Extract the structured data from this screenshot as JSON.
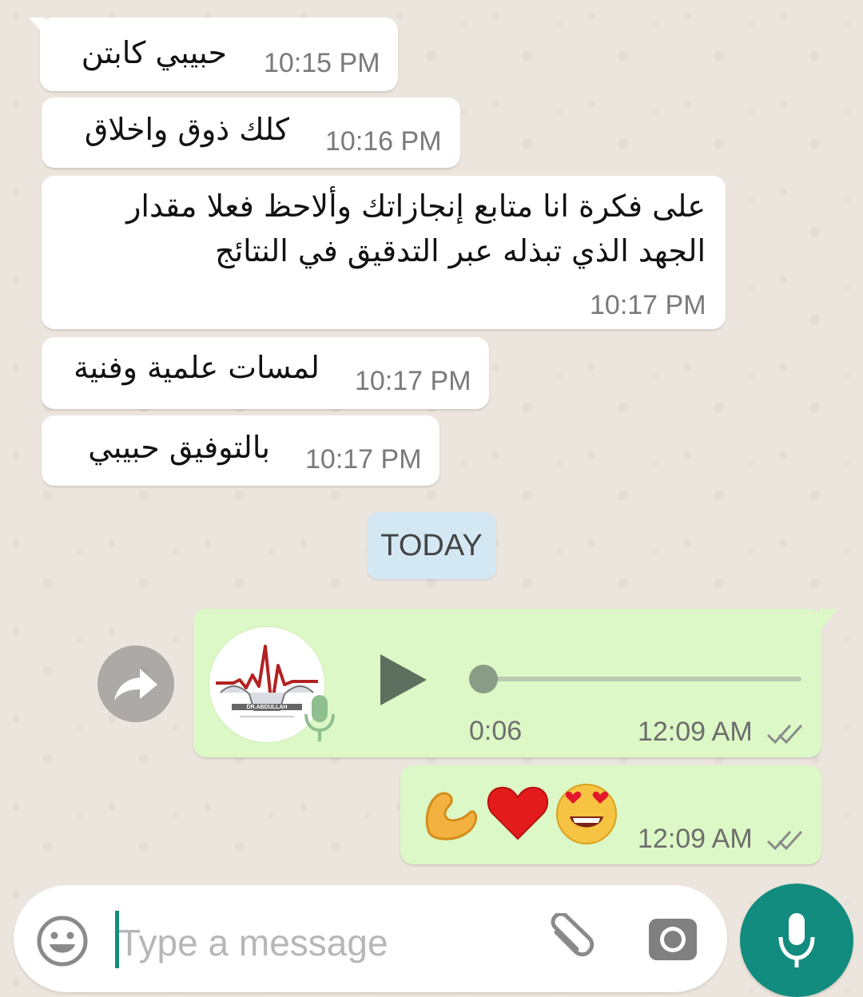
{
  "messages": [
    {
      "text": "حبيبي كابتن",
      "time": "10:15 PM"
    },
    {
      "text": "كلك ذوق واخلاق",
      "time": "10:16 PM"
    },
    {
      "lines": [
        "على فكرة انا متابع إنجازاتك وألاحظ فعلا مقدار",
        "الجهد الذي تبذله عبر التدقيق في النتائج"
      ],
      "time": "10:17 PM"
    },
    {
      "text": "لمسات علمية وفنية",
      "time": "10:17 PM"
    },
    {
      "text": "بالتوفيق حبيبي",
      "time": "10:17 PM"
    }
  ],
  "date_separator": "TODAY",
  "voice_message": {
    "duration": "0:06",
    "time": "12:09 AM",
    "status": "delivered",
    "progress": 0.0,
    "logo_text": "DR.ABDULLAH"
  },
  "emoji_message": {
    "emojis": [
      "💪",
      "❤️",
      "😍"
    ],
    "time": "12:09 AM",
    "status": "delivered"
  },
  "composer": {
    "placeholder": "Type a message"
  },
  "colors": {
    "background": "#ece5dd",
    "incoming_bubble": "#ffffff",
    "outgoing_bubble": "#dcf8c6",
    "accent": "#128c7e",
    "date_chip": "#d4e8f4"
  },
  "icons": {
    "emoji_button": "smiley-icon",
    "attach_button": "paperclip-icon",
    "camera_button": "camera-icon",
    "mic_button": "microphone-icon",
    "forward_button": "forward-icon",
    "play_button": "play-icon"
  }
}
